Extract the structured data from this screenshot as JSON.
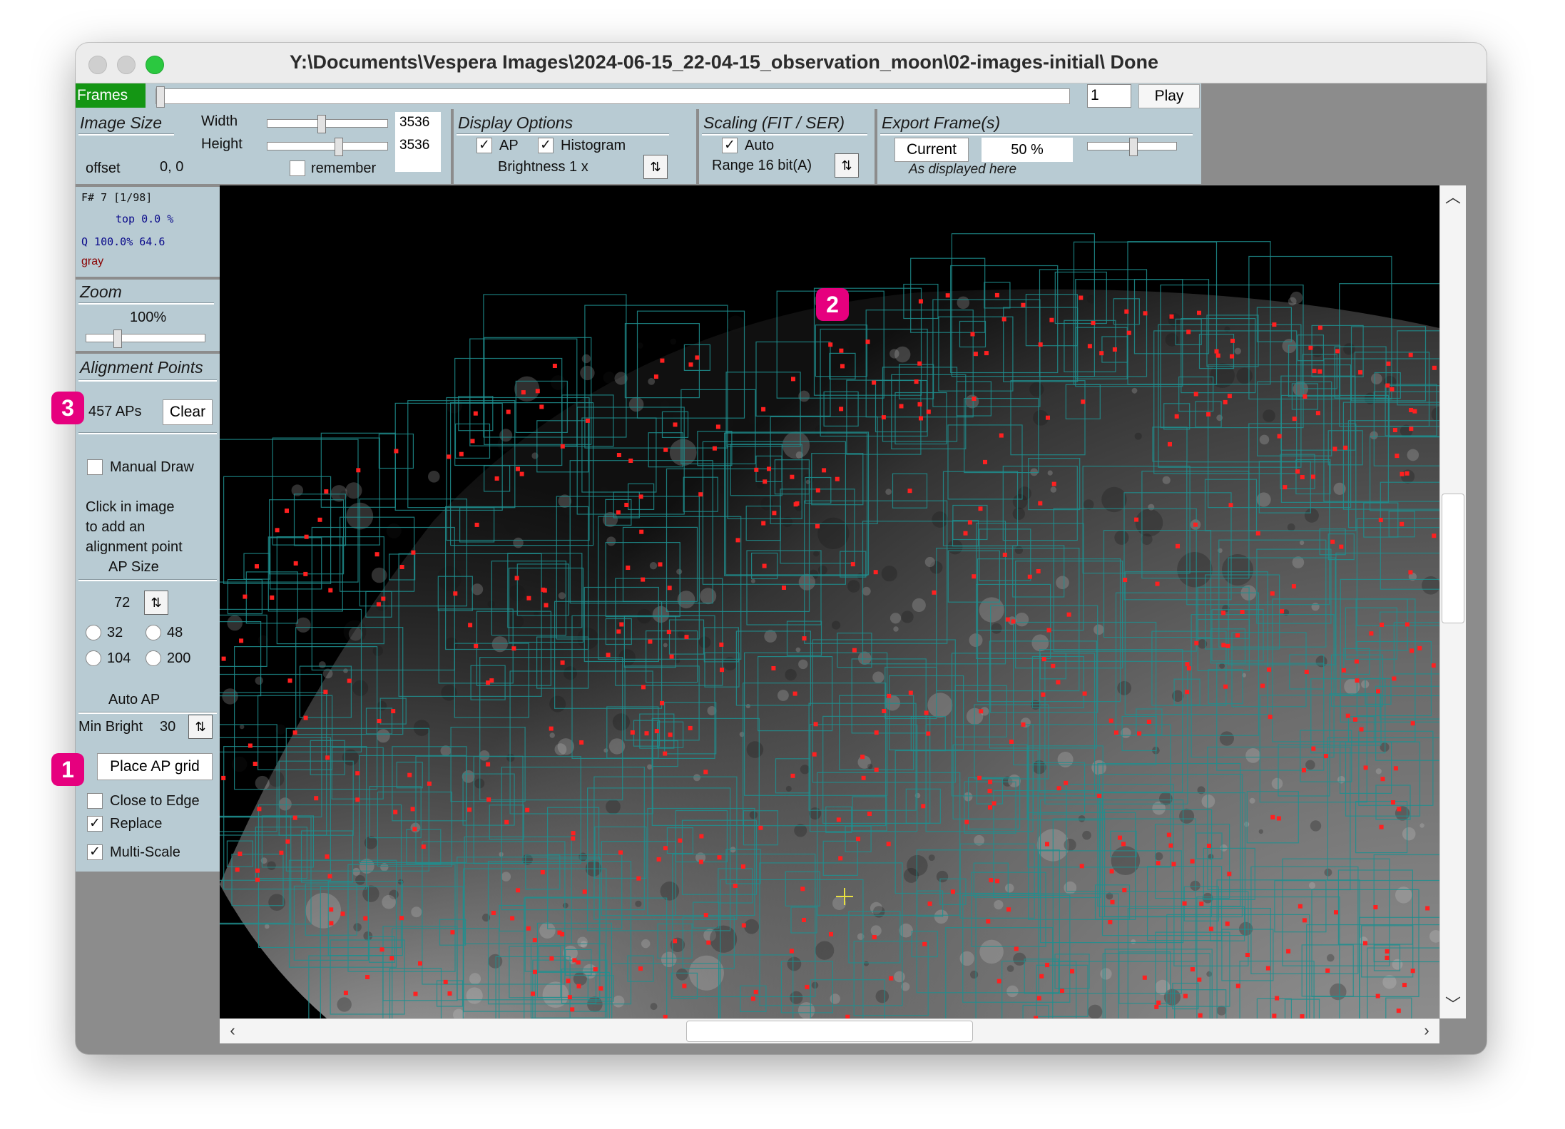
{
  "window": {
    "title": "Y:\\Documents\\Vespera Images\\2024-06-15_22-04-15_observation_moon\\02-images-initial\\  Done"
  },
  "frames": {
    "label": "Frames",
    "value": "1",
    "play_label": "Play",
    "position": 0.0
  },
  "image_size": {
    "title": "Image Size",
    "width_label": "Width",
    "width_value": "3536",
    "height_label": "Height",
    "height_value": "3536",
    "offset_label": "offset",
    "offset_value": "0, 0",
    "remember_label": "remember",
    "remember_checked": false
  },
  "display_options": {
    "title": "Display Options",
    "ap_label": "AP",
    "ap_checked": true,
    "histogram_label": "Histogram",
    "histogram_checked": true,
    "brightness_label": "Brightness 1 x"
  },
  "scaling": {
    "title": "Scaling (FIT / SER)",
    "auto_label": "Auto",
    "auto_checked": true,
    "range_label": "Range 16 bit(A)"
  },
  "export": {
    "title": "Export Frame(s)",
    "current_label": "Current",
    "percent_value": "50 %",
    "subtitle": "As displayed here"
  },
  "frame_info": {
    "frame": "F# 7  [1/98]",
    "top": "top 0.0  %",
    "quality": "Q 100.0%   64.6",
    "color": "gray"
  },
  "zoom": {
    "title": "Zoom",
    "value": "100%"
  },
  "alignment_points": {
    "title": "Alignment Points",
    "count_label": "457 APs",
    "clear_label": "Clear",
    "manual_draw_label": "Manual Draw",
    "manual_draw_checked": false,
    "hint_line1": "Click in image",
    "hint_line2": "to add an",
    "hint_line3": "alignment point",
    "ap_size_label": "AP Size",
    "ap_size_value": "72",
    "size_options": [
      "32",
      "48",
      "104",
      "200"
    ],
    "auto_ap_label": "Auto AP",
    "min_bright_label": "Min Bright",
    "min_bright_value": "30",
    "place_grid_label": "Place AP grid",
    "close_to_edge_label": "Close to Edge",
    "close_to_edge_checked": false,
    "replace_label": "Replace",
    "replace_checked": true,
    "multi_scale_label": "Multi-Scale",
    "multi_scale_checked": true
  },
  "markers": [
    "1",
    "2",
    "3"
  ],
  "colors": {
    "panel": "#b8cbd3",
    "ap_box": "#1f8f8f",
    "ap_point": "#ff2020",
    "marker": "#e6007e",
    "frames_green": "#149614"
  },
  "icons": {
    "spin": "up-down-arrows-icon",
    "scroll_up": "chevron-up-icon",
    "scroll_down": "chevron-down-icon",
    "scroll_left": "chevron-left-icon",
    "scroll_right": "chevron-right-icon",
    "cursor": "crosshair-icon"
  }
}
